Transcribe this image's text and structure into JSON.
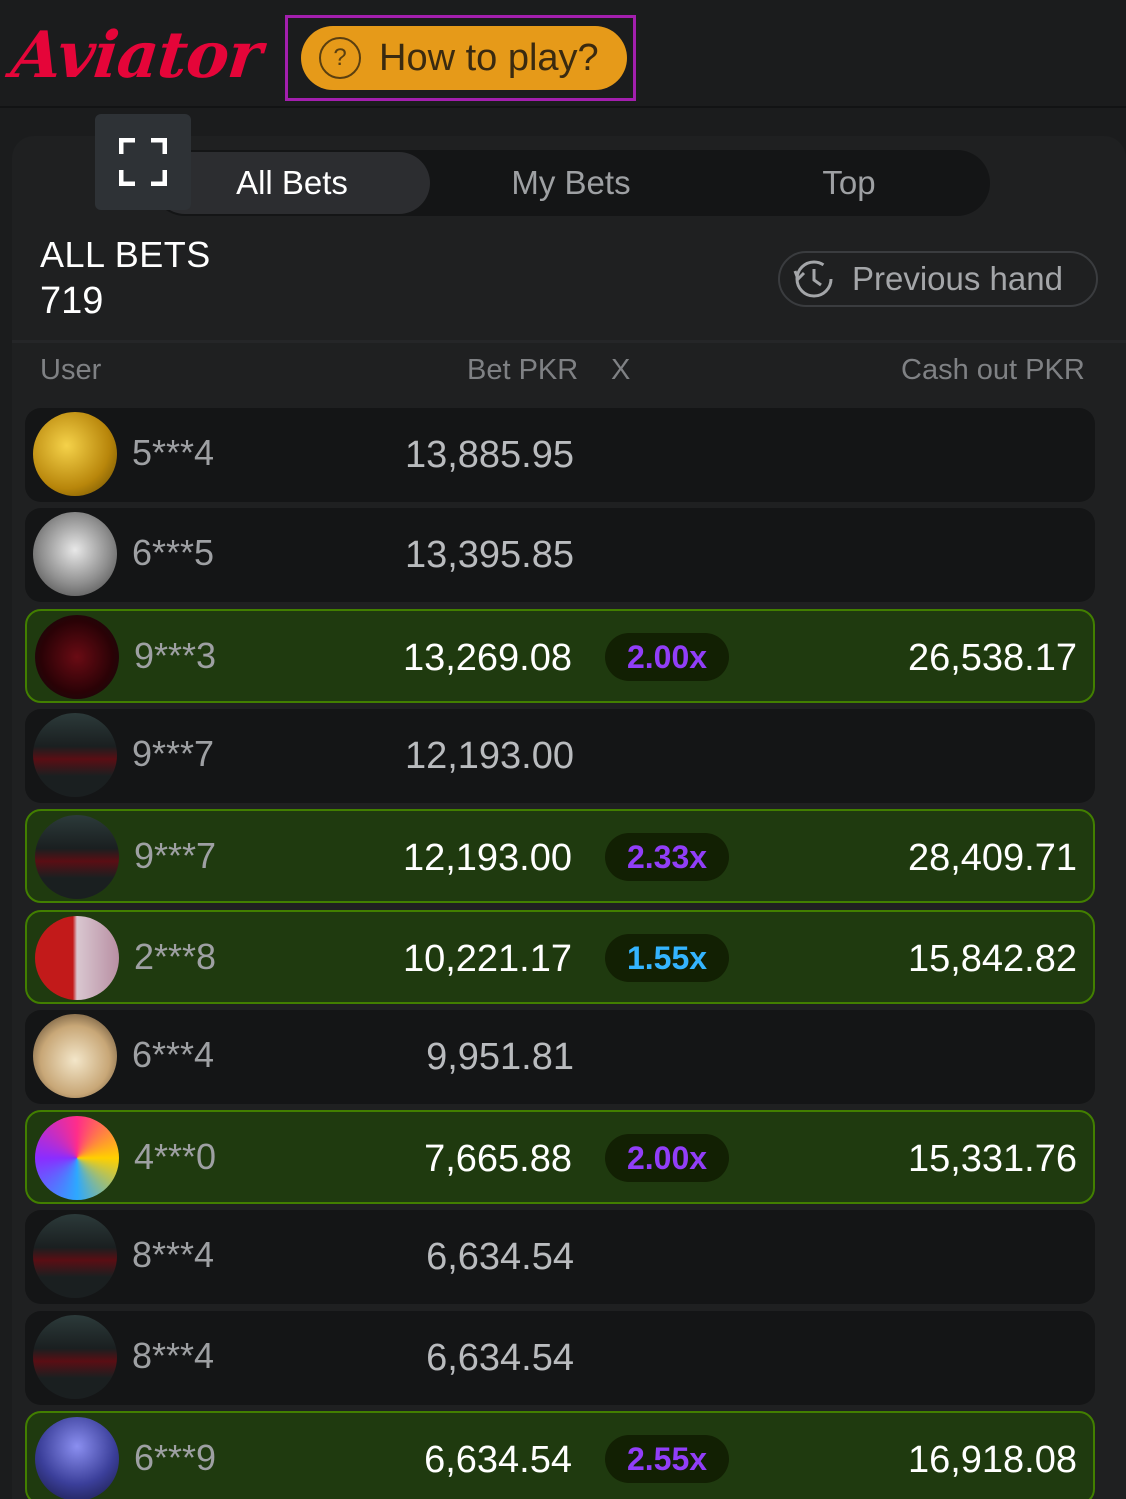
{
  "header": {
    "logo": "Aviator",
    "how_to_play": "How to play?",
    "how_to_play_icon": "question-circle-icon"
  },
  "tabs": [
    {
      "label": "All Bets",
      "active": true
    },
    {
      "label": "My Bets",
      "active": false
    },
    {
      "label": "Top",
      "active": false
    }
  ],
  "summary": {
    "title": "ALL BETS",
    "count": "719",
    "previous_hand": "Previous hand"
  },
  "columns": {
    "user": "User",
    "bet": "Bet PKR",
    "x": "X",
    "cashout": "Cash out PKR"
  },
  "colors": {
    "brand": "#e50539",
    "accent": "#e69a19",
    "win_bg": "#1f3a0f",
    "win_border": "#427f00",
    "mult_purple": "#913ef8",
    "mult_blue": "#34b4ff"
  },
  "bets": [
    {
      "user": "5***4",
      "bet": "13,885.95",
      "mult": "",
      "cashout": "",
      "avatar": "gold-avatar"
    },
    {
      "user": "6***5",
      "bet": "13,395.85",
      "mult": "",
      "cashout": "",
      "avatar": "silver-avatar"
    },
    {
      "user": "9***3",
      "bet": "13,269.08",
      "mult": "2.00x",
      "cashout": "26,538.17",
      "mult_color": "#913ef8",
      "avatar": "mask-avatar"
    },
    {
      "user": "9***7",
      "bet": "12,193.00",
      "mult": "",
      "cashout": "",
      "avatar": "car-avatar"
    },
    {
      "user": "9***7",
      "bet": "12,193.00",
      "mult": "2.33x",
      "cashout": "28,409.71",
      "mult_color": "#913ef8",
      "avatar": "car-avatar"
    },
    {
      "user": "2***8",
      "bet": "10,221.17",
      "mult": "1.55x",
      "cashout": "15,842.82",
      "mult_color": "#34b4ff",
      "avatar": "split-avatar"
    },
    {
      "user": "6***4",
      "bet": "9,951.81",
      "mult": "",
      "cashout": "",
      "avatar": "dog-avatar"
    },
    {
      "user": "4***0",
      "bet": "7,665.88",
      "mult": "2.00x",
      "cashout": "15,331.76",
      "mult_color": "#913ef8",
      "avatar": "candy-avatar"
    },
    {
      "user": "8***4",
      "bet": "6,634.54",
      "mult": "",
      "cashout": "",
      "avatar": "car-avatar"
    },
    {
      "user": "8***4",
      "bet": "6,634.54",
      "mult": "",
      "cashout": "",
      "avatar": "car-avatar"
    },
    {
      "user": "6***9",
      "bet": "6,634.54",
      "mult": "2.55x",
      "cashout": "16,918.08",
      "mult_color": "#913ef8",
      "avatar": "hood-avatar"
    }
  ]
}
